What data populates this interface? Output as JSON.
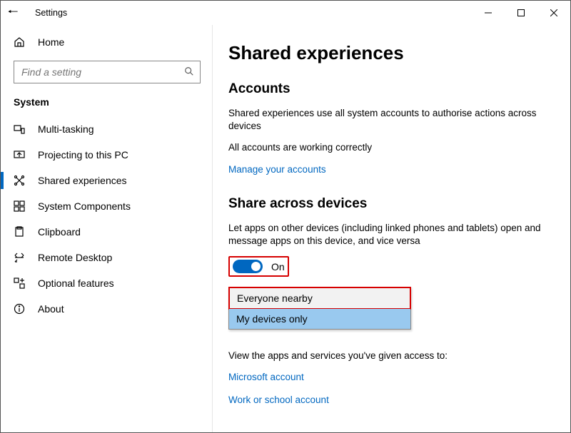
{
  "window": {
    "title": "Settings"
  },
  "sidebar": {
    "home": "Home",
    "search_placeholder": "Find a setting",
    "category": "System",
    "items": [
      {
        "label": "Multi-tasking"
      },
      {
        "label": "Projecting to this PC"
      },
      {
        "label": "Shared experiences",
        "active": true
      },
      {
        "label": "System Components"
      },
      {
        "label": "Clipboard"
      },
      {
        "label": "Remote Desktop"
      },
      {
        "label": "Optional features"
      },
      {
        "label": "About"
      }
    ]
  },
  "main": {
    "title": "Shared experiences",
    "accounts": {
      "heading": "Accounts",
      "desc": "Shared experiences use all system accounts to authorise actions across devices",
      "status": "All accounts are working correctly",
      "manage_link": "Manage your accounts"
    },
    "share": {
      "heading": "Share across devices",
      "desc": "Let apps on other devices (including linked phones and tablets) open and message apps on this device, and vice versa",
      "toggle_on": true,
      "toggle_label": "On",
      "dropdown": {
        "options": [
          "Everyone nearby",
          "My devices only"
        ],
        "selected_index": 1
      },
      "access_text": "View the apps and services you've given access to:",
      "ms_link": "Microsoft account",
      "work_link": "Work or school account"
    }
  }
}
